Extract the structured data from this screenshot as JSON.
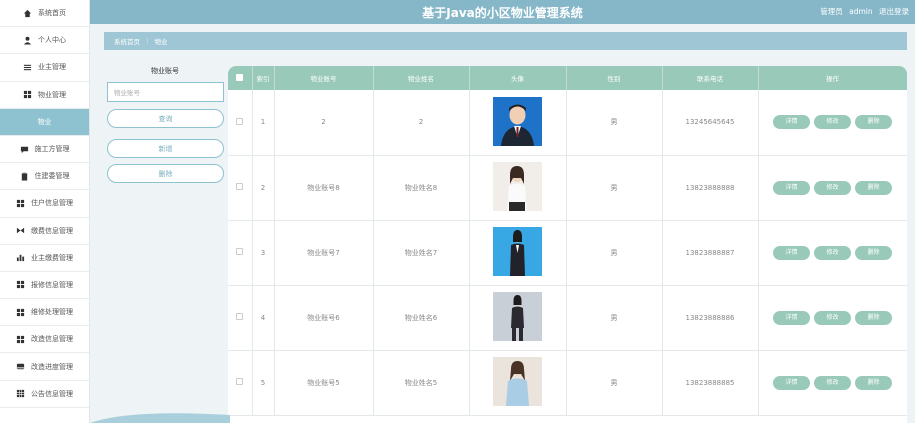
{
  "app": {
    "title": "基于Java的小区物业管理系统"
  },
  "user": {
    "role": "管理员",
    "name": "admin",
    "logout": "退出登录"
  },
  "sidebar": {
    "items": [
      {
        "label": "系统首页",
        "icon": "home-icon"
      },
      {
        "label": "个人中心",
        "icon": "person-icon"
      },
      {
        "label": "业主管理",
        "icon": "list-icon"
      },
      {
        "label": "物业管理",
        "icon": "grid-icon"
      },
      {
        "label": "物业",
        "icon": "",
        "active": true
      },
      {
        "label": "施工方管理",
        "icon": "chat-icon"
      },
      {
        "label": "住建委管理",
        "icon": "clipboard-icon"
      },
      {
        "label": "住户信息管理",
        "icon": "grid-icon"
      },
      {
        "label": "缴费信息管理",
        "icon": "shuffle-icon"
      },
      {
        "label": "业主缴费管理",
        "icon": "bar-chart-icon"
      },
      {
        "label": "报修信息管理",
        "icon": "grid-icon"
      },
      {
        "label": "维修处理管理",
        "icon": "grid-icon"
      },
      {
        "label": "改造信息管理",
        "icon": "grid-icon"
      },
      {
        "label": "改造进度管理",
        "icon": "card-icon"
      },
      {
        "label": "公告信息管理",
        "icon": "table-icon"
      }
    ]
  },
  "breadcrumb": {
    "home": "系统首页",
    "sep": "⋮",
    "current": "物业"
  },
  "search": {
    "label": "物业账号",
    "placeholder": "物业账号",
    "query": "查询",
    "add": "新增",
    "delete": "删除"
  },
  "table": {
    "headers": {
      "index": "索引",
      "account": "物业账号",
      "name": "物业姓名",
      "avatar": "头像",
      "gender": "性别",
      "phone": "联系电话",
      "actions": "操作"
    },
    "actions": {
      "detail": "详情",
      "edit": "修改",
      "delete": "删除"
    },
    "rows": [
      {
        "index": "1",
        "account": "2",
        "name": "2",
        "gender": "男",
        "phone": "13245645645",
        "avatar": "man-suit"
      },
      {
        "index": "2",
        "account": "物业账号8",
        "name": "物业姓名8",
        "gender": "男",
        "phone": "13823888888",
        "avatar": "woman-white"
      },
      {
        "index": "3",
        "account": "物业账号7",
        "name": "物业姓名7",
        "gender": "男",
        "phone": "13823888887",
        "avatar": "woman-blue-bg"
      },
      {
        "index": "4",
        "account": "物业账号6",
        "name": "物业姓名6",
        "gender": "男",
        "phone": "13823888886",
        "avatar": "woman-grey-bg"
      },
      {
        "index": "5",
        "account": "物业账号5",
        "name": "物业姓名5",
        "gender": "男",
        "phone": "13823888885",
        "avatar": "woman-light"
      }
    ]
  },
  "colors": {
    "header": "#86b7c9",
    "accent": "#99c9b9",
    "active_nav": "#8ec2d0"
  }
}
